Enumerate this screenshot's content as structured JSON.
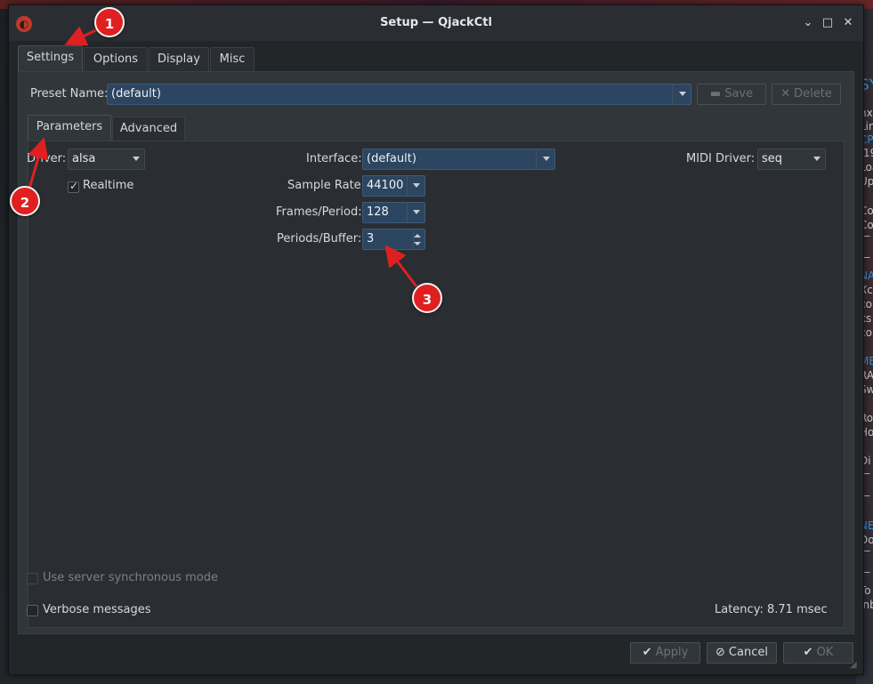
{
  "window": {
    "title": "Setup — QjackCtl",
    "icon": "qjackctl-icon",
    "controls": [
      "minimize-icon",
      "maximize-icon",
      "close-icon"
    ]
  },
  "main_tabs": [
    {
      "label": "Settings",
      "active": true
    },
    {
      "label": "Options"
    },
    {
      "label": "Display"
    },
    {
      "label": "Misc"
    }
  ],
  "preset": {
    "label": "Preset Name:",
    "value": "(default)",
    "save_label": "Save",
    "delete_label": "Delete"
  },
  "sub_tabs": [
    {
      "label": "Parameters",
      "active": true
    },
    {
      "label": "Advanced"
    }
  ],
  "params": {
    "driver_label": "Driver:",
    "driver_value": "alsa",
    "realtime_label": "Realtime",
    "realtime_checked": true,
    "interface_label": "Interface:",
    "interface_value": "(default)",
    "midi_label": "MIDI Driver:",
    "midi_value": "seq",
    "sample_rate_label": "Sample Rate:",
    "sample_rate_value": "44100",
    "frames_label": "Frames/Period:",
    "frames_value": "128",
    "periods_label": "Periods/Buffer:",
    "periods_value": "3",
    "sync_label": "Use server synchronous mode",
    "verbose_label": "Verbose messages",
    "latency_label": "Latency:",
    "latency_value": "8.71 msec"
  },
  "footer": {
    "apply_label": "Apply",
    "cancel_label": "Cancel",
    "ok_label": "OK"
  },
  "annotations": [
    "1",
    "2",
    "3"
  ],
  "background_text": [
    {
      "text": "SY",
      "blue": true
    },
    {
      "text": "nx"
    },
    {
      "text": "Lin"
    },
    {
      "text": "CP",
      "blue": true
    },
    {
      "text": ":19"
    },
    {
      "text": "Loa"
    },
    {
      "text": "Up"
    },
    {
      "text": "Co"
    },
    {
      "text": "Co"
    },
    {
      "text": "—"
    },
    {
      "text": "—"
    },
    {
      "text": "NA",
      "blue": true
    },
    {
      "text": "Xc"
    },
    {
      "text": "co"
    },
    {
      "text": "ks"
    },
    {
      "text": "co"
    },
    {
      "text": "ME",
      "blue": true
    },
    {
      "text": "RA"
    },
    {
      "text": "Sw"
    },
    {
      "text": "Ro"
    },
    {
      "text": "Ho"
    },
    {
      "text": "Di"
    },
    {
      "text": "—"
    },
    {
      "text": "—"
    },
    {
      "text": "NE",
      "blue": true
    },
    {
      "text": "Do"
    },
    {
      "text": "—"
    },
    {
      "text": "—"
    },
    {
      "text": "To"
    },
    {
      "text": "Inb"
    }
  ]
}
